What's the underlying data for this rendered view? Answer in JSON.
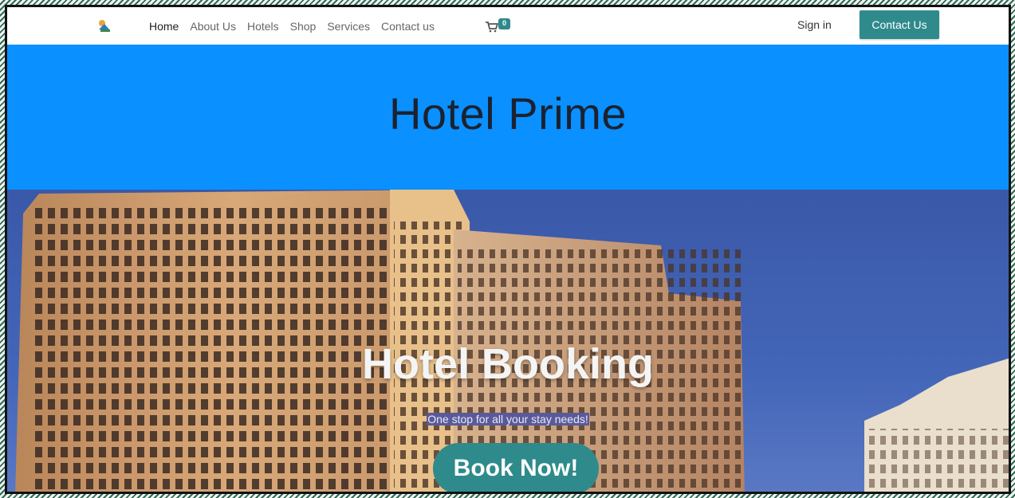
{
  "nav": {
    "links": [
      "Home",
      "About Us",
      "Hotels",
      "Shop",
      "Services",
      "Contact us"
    ],
    "cart_count": "0",
    "signin": "Sign in",
    "contact_button": "Contact Us"
  },
  "banner": {
    "title": "Hotel Prime"
  },
  "hero": {
    "title": "Hotel Booking",
    "subtitle": "One stop for all your stay needs!",
    "cta": "Book Now!"
  },
  "colors": {
    "accent": "#2f8a8c",
    "banner_blue": "#0a90ff"
  },
  "icons": {
    "logo": "logo-icon",
    "cart": "cart-icon"
  }
}
